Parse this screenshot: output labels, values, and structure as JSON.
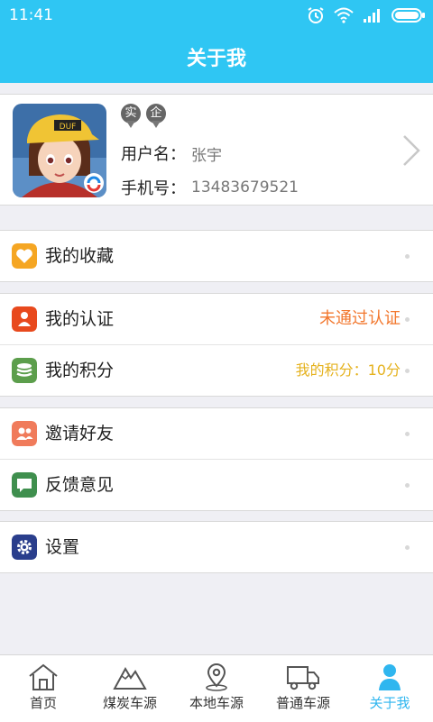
{
  "status_bar": {
    "time": "11:41"
  },
  "header": {
    "title": "关于我"
  },
  "profile": {
    "badges": [
      "实",
      "企"
    ],
    "username_label": "用户名：",
    "username": "张宇",
    "phone_label": "手机号：",
    "phone": "13483679521"
  },
  "menu": {
    "favorites": {
      "label": "我的收藏"
    },
    "certification": {
      "label": "我的认证",
      "value": "未通过认证"
    },
    "points": {
      "label": "我的积分",
      "value": "我的积分：10分"
    },
    "invite": {
      "label": "邀请好友"
    },
    "feedback": {
      "label": "反馈意见"
    },
    "settings": {
      "label": "设置"
    }
  },
  "colors": {
    "accent": "#2fc6f3",
    "cert_status": "#f2772d",
    "points_value": "#e5b21e"
  },
  "bottom_nav": {
    "home": "首页",
    "coal": "煤炭车源",
    "local": "本地车源",
    "normal": "普通车源",
    "about": "关于我"
  }
}
